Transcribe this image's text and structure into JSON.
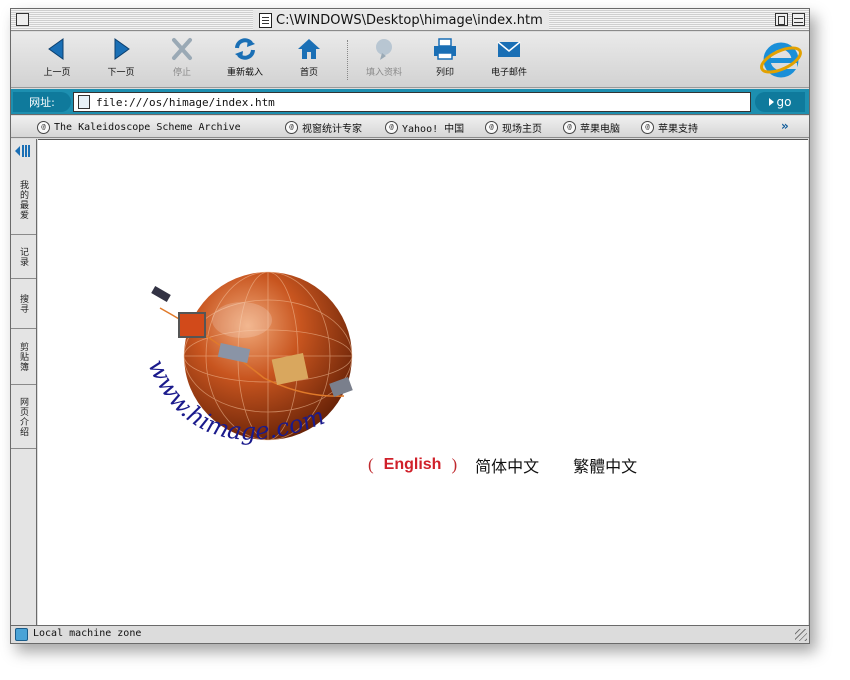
{
  "window": {
    "title": "C:\\WINDOWS\\Desktop\\himage\\index.htm"
  },
  "toolbar": {
    "back_label": "上一页",
    "forward_label": "下一页",
    "stop_label": "停止",
    "refresh_label": "重新载入",
    "home_label": "首页",
    "autofill_label": "填入资料",
    "print_label": "列印",
    "mail_label": "电子邮件"
  },
  "address": {
    "label": "网址:",
    "url": "file:///os/himage/index.htm",
    "go_label": "go"
  },
  "favorites": {
    "items": [
      "The Kaleidoscope Scheme Archive",
      "视窗统计专家",
      "Yahoo! 中国",
      "现场主页",
      "苹果电脑",
      "苹果支持"
    ]
  },
  "sidebar": {
    "tabs": [
      "我的最爱",
      "记录",
      "搜寻",
      "剪贴簿",
      "网页介绍"
    ]
  },
  "page": {
    "logo_text": "www.himage.com",
    "lang_open": "(",
    "lang_english": "English",
    "lang_close": ")",
    "lang_simplified": "简体中文",
    "lang_traditional": "繁體中文"
  },
  "status": {
    "text": "Local machine zone"
  },
  "colors": {
    "accent": "#1d8fb0",
    "icon_blue": "#1a6fb5",
    "link_red": "#d0202a",
    "logo_text": "#1a1a8c"
  }
}
